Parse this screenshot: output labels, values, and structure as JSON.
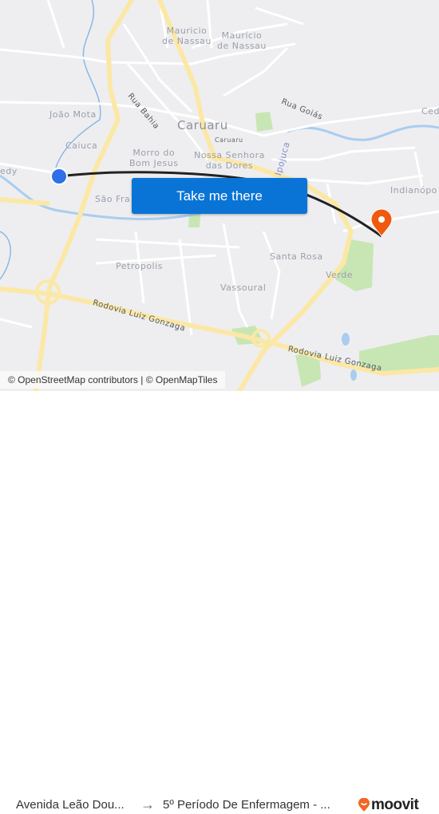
{
  "map": {
    "labels": {
      "mauricio_nassau_1": "Mauricio\nde Nassau",
      "mauricio_nassau_2": "Maurício\nde Nassau",
      "rua_bahia": "Rua Bahia",
      "rua_goias": "Rua Goiás",
      "joao_mota": "João Mota",
      "caiuca": "Caiuca",
      "caruaru": "Caruaru",
      "caruaru_small": "Caruaru",
      "morro_bom_jesus": "Morro do\nBom Jesus",
      "nossa_senhora": "Nossa Senhora\ndas Dores",
      "ipojuca": "Ipojuca",
      "cedro": "Ced",
      "indianopolis": "Indianópo",
      "kennedy": "edy",
      "sao_francisco": "São Fra",
      "petropolis": "Petropolis",
      "santa_rosa": "Santa Rosa",
      "vassoural": "Vassoural",
      "verde": "Verde",
      "rodovia_1": "Rodovia Luiz Gonzaga",
      "rodovia_2": "Rodovia Luiz Gonzaga"
    },
    "origin_marker": {
      "icon": "origin-dot-icon",
      "color": "#2f6fe8"
    },
    "destination_marker": {
      "icon": "map-pin-icon",
      "color": "#f05a0f"
    },
    "route_color": "#222222"
  },
  "cta": {
    "label": "Take me there",
    "color": "#0a74d6"
  },
  "attribution": "© OpenStreetMap contributors | © OpenMapTiles",
  "footer": {
    "origin": "Avenida Leão Dou...",
    "arrow_icon": "arrow-right-icon",
    "destination": "5º Período De Enfermagem - ...",
    "brand": "moovit",
    "brand_color": "#f26722"
  }
}
